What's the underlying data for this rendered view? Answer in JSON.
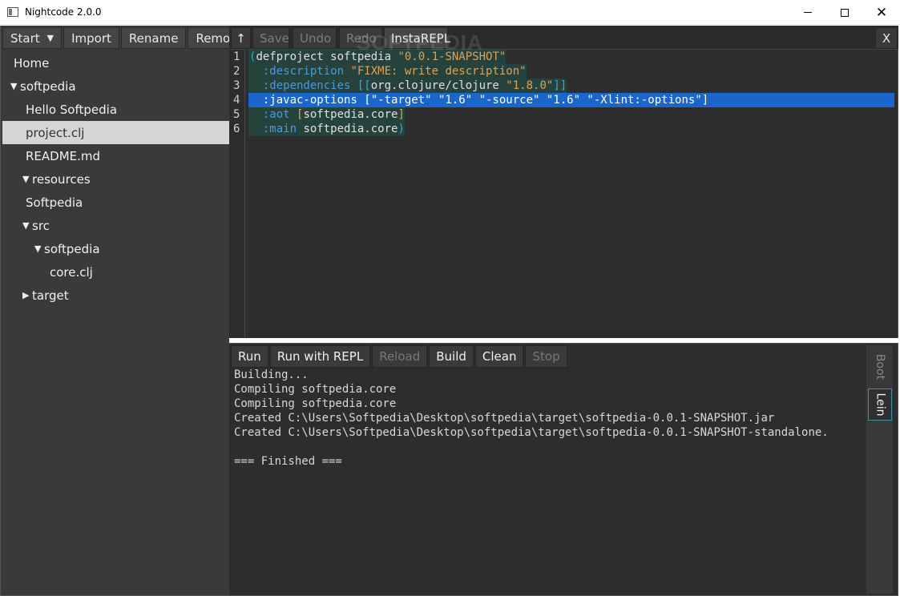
{
  "window": {
    "title": "Nightcode 2.0.0",
    "minimize_label": "",
    "maximize_label": "",
    "close_label": "✕"
  },
  "left_toolbar": {
    "start": "Start",
    "import": "Import",
    "rename": "Rename",
    "remove": "Remove"
  },
  "tree": [
    {
      "label": "Home",
      "expanded": null,
      "indent": 0,
      "selected": false
    },
    {
      "label": "softpedia",
      "expanded": true,
      "indent": 0,
      "selected": false
    },
    {
      "label": "Hello Softpedia",
      "expanded": null,
      "indent": 1,
      "selected": false
    },
    {
      "label": "project.clj",
      "expanded": null,
      "indent": 1,
      "selected": true
    },
    {
      "label": "README.md",
      "expanded": null,
      "indent": 1,
      "selected": false
    },
    {
      "label": "resources",
      "expanded": true,
      "indent": 1,
      "selected": false
    },
    {
      "label": "Softpedia",
      "expanded": null,
      "indent": 1,
      "selected": false
    },
    {
      "label": "src",
      "expanded": true,
      "indent": 1,
      "selected": false
    },
    {
      "label": "softpedia",
      "expanded": true,
      "indent": 2,
      "selected": false
    },
    {
      "label": "core.clj",
      "expanded": null,
      "indent": 3,
      "selected": false
    },
    {
      "label": "target",
      "expanded": false,
      "indent": 1,
      "selected": false
    }
  ],
  "editor_toolbar": {
    "up": "↑",
    "save": "Save",
    "undo": "Undo",
    "redo": "Redo",
    "instarepl": "InstaREPL",
    "close": "X"
  },
  "watermark": "SOFTPEDIA",
  "code": {
    "line_numbers": [
      "1",
      "2",
      "3",
      "4",
      "5",
      "6"
    ],
    "lines": [
      {
        "highlight": "teal",
        "tokens": [
          {
            "t": "(",
            "c": "#3aa3d8"
          },
          {
            "t": "defproject softpedia ",
            "c": "#e0e0e0"
          },
          {
            "t": "\"0.0.1-SNAPSHOT\"",
            "c": "#e0a05a"
          }
        ]
      },
      {
        "highlight": "teal",
        "tokens": [
          {
            "t": "  :description ",
            "c": "#4a9ad8"
          },
          {
            "t": "\"FIXME: write description\"",
            "c": "#e0a05a"
          }
        ]
      },
      {
        "highlight": "teal",
        "tokens": [
          {
            "t": "  :dependencies ",
            "c": "#4a9ad8"
          },
          {
            "t": "[[",
            "c": "#3aa3d8"
          },
          {
            "t": "org.clojure/clojure ",
            "c": "#e0e0e0"
          },
          {
            "t": "\"1.8.0\"",
            "c": "#e0a05a"
          },
          {
            "t": "]]",
            "c": "#3aa3d8"
          }
        ]
      },
      {
        "highlight": "selected",
        "tokens": [
          {
            "t": "  :javac-options [\"-target\" \"1.6\" \"-source\" \"1.6\" \"-Xlint:-options\"]",
            "c": "#ffffff"
          }
        ]
      },
      {
        "highlight": "teal",
        "tokens": [
          {
            "t": "  :aot ",
            "c": "#4a9ad8"
          },
          {
            "t": "[",
            "c": "#e0a05a"
          },
          {
            "t": "softpedia.core",
            "c": "#e0e0e0"
          },
          {
            "t": "]",
            "c": "#e0a05a"
          }
        ]
      },
      {
        "highlight": "teal",
        "tokens": [
          {
            "t": "  :main ",
            "c": "#4a9ad8"
          },
          {
            "t": "softpedia.core",
            "c": "#e0e0e0"
          },
          {
            "t": ")",
            "c": "#3aa3d8"
          }
        ]
      }
    ]
  },
  "console_toolbar": {
    "run": "Run",
    "run_with_repl": "Run with REPL",
    "reload": "Reload",
    "build": "Build",
    "clean": "Clean",
    "stop": "Stop"
  },
  "console": {
    "lines": [
      "Building...",
      "Compiling softpedia.core",
      "Compiling softpedia.core",
      "Created C:\\Users\\Softpedia\\Desktop\\softpedia\\target\\softpedia-0.0.1-SNAPSHOT.jar",
      "Created C:\\Users\\Softpedia\\Desktop\\softpedia\\target\\softpedia-0.0.1-SNAPSHOT-standalone.",
      "",
      "=== Finished ==="
    ]
  },
  "side_tabs": {
    "boot": "Boot",
    "lein": "Lein"
  }
}
